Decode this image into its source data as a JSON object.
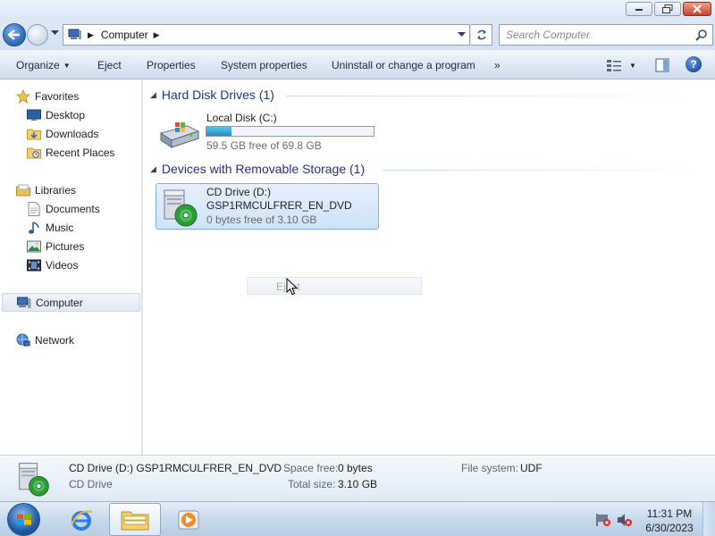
{
  "window": {
    "controls": [
      "minimize-icon",
      "restore-icon",
      "close-icon"
    ]
  },
  "address": {
    "location": "Computer",
    "search_placeholder": "Search Computer"
  },
  "commands": {
    "organize": "Organize",
    "eject": "Eject",
    "properties": "Properties",
    "system_properties": "System properties",
    "uninstall": "Uninstall or change a program",
    "more": "»"
  },
  "nav": {
    "favorites": "Favorites",
    "desktop": "Desktop",
    "downloads": "Downloads",
    "recent_places": "Recent Places",
    "libraries": "Libraries",
    "documents": "Documents",
    "music": "Music",
    "pictures": "Pictures",
    "videos": "Videos",
    "computer": "Computer",
    "network": "Network"
  },
  "groups": {
    "hard_disk": "Hard Disk Drives (1)",
    "removable": "Devices with Removable Storage (1)"
  },
  "drives": {
    "local": {
      "name": "Local Disk (C:)",
      "free": "59.5 GB free of 69.8 GB",
      "used_fraction": 0.148
    },
    "cd": {
      "name": "CD Drive (D:)",
      "label": "GSP1RMCULFRER_EN_DVD",
      "free": "0 bytes free of 3.10 GB"
    }
  },
  "context_ghost": {
    "label": "Eject"
  },
  "details": {
    "title": "CD Drive (D:) GSP1RMCULFRER_EN_DVD",
    "type": "CD Drive",
    "space_free_label": "Space free:",
    "space_free": "0 bytes",
    "total_size_label": "Total size:",
    "total_size": "3.10 GB",
    "file_system_label": "File system:",
    "file_system": "UDF"
  },
  "taskbar": {
    "time": "11:31 PM",
    "date": "6/30/2023"
  }
}
